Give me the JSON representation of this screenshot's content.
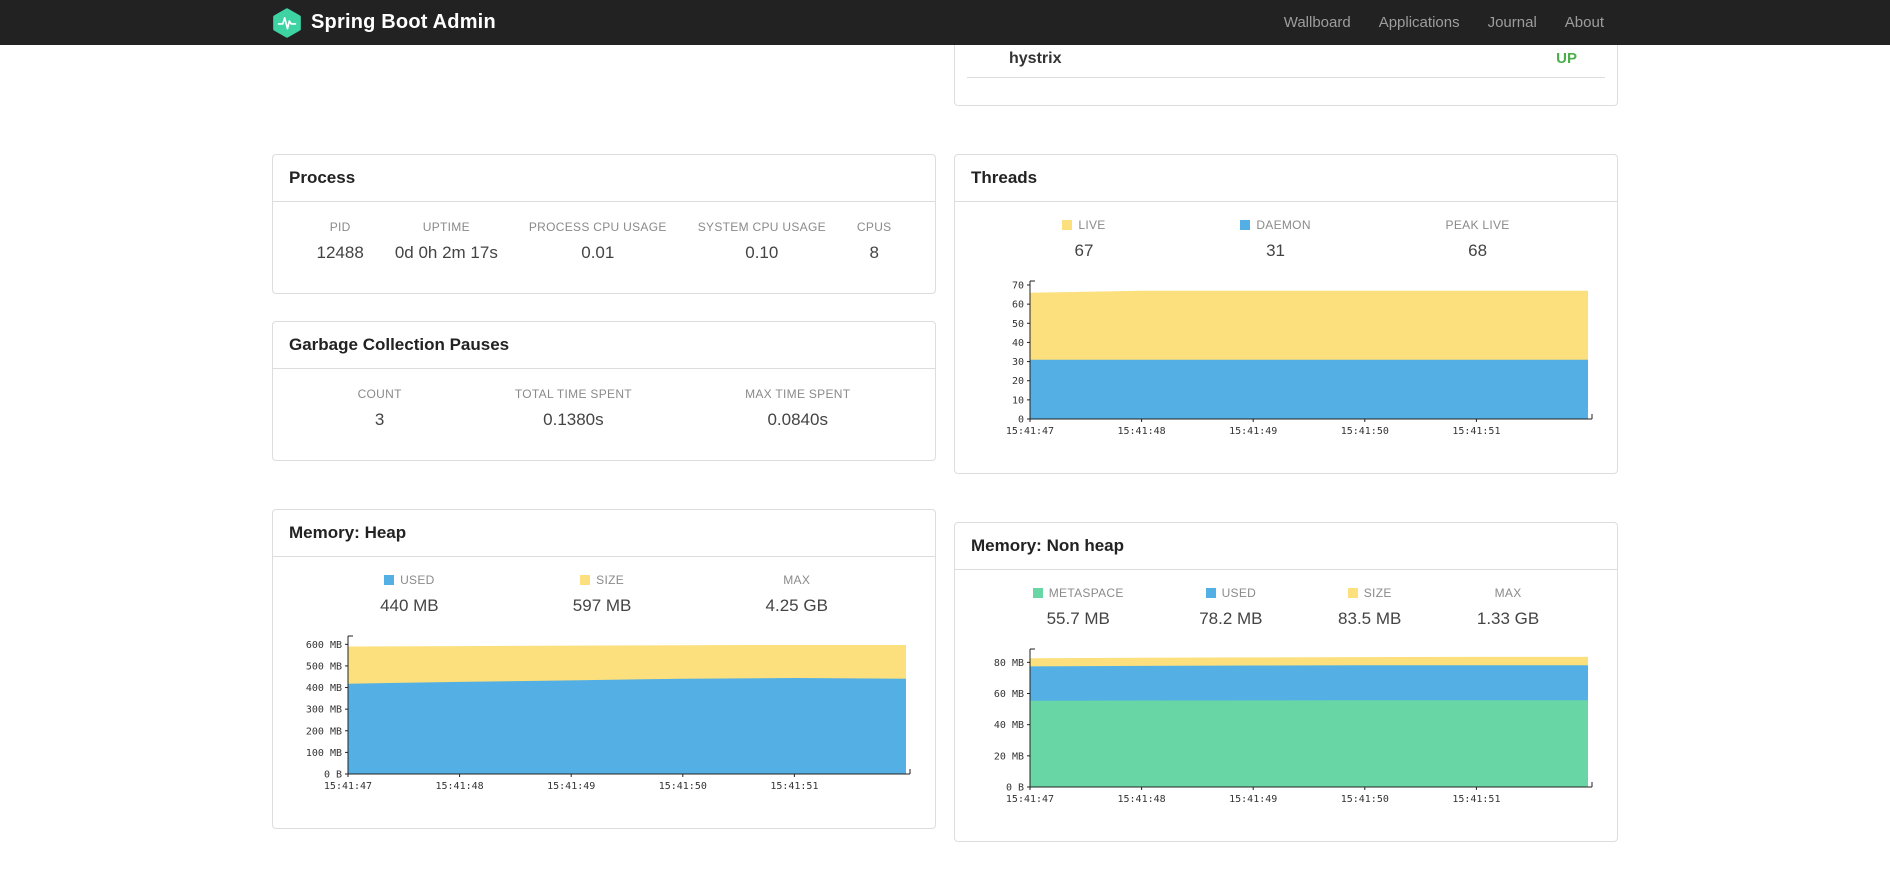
{
  "navbar": {
    "brand": "Spring Boot Admin",
    "items": [
      {
        "label": "Wallboard"
      },
      {
        "label": "Applications"
      },
      {
        "label": "Journal"
      },
      {
        "label": "About"
      }
    ]
  },
  "colors": {
    "logo_teal": "#3ed3a3",
    "status_up": "#4cae4c",
    "chart_yellow": "#fbe07d",
    "chart_blue": "#54b0e4",
    "chart_green": "#68d7a5"
  },
  "health": {
    "rows": [
      {
        "name": "hystrix",
        "status": "UP"
      }
    ]
  },
  "process": {
    "title": "Process",
    "stats": [
      {
        "label": "PID",
        "value": "12488"
      },
      {
        "label": "UPTIME",
        "value": "0d 0h 2m 17s"
      },
      {
        "label": "PROCESS CPU USAGE",
        "value": "0.01"
      },
      {
        "label": "SYSTEM CPU USAGE",
        "value": "0.10"
      },
      {
        "label": "CPUS",
        "value": "8"
      }
    ]
  },
  "gc": {
    "title": "Garbage Collection Pauses",
    "stats": [
      {
        "label": "COUNT",
        "value": "3"
      },
      {
        "label": "TOTAL TIME SPENT",
        "value": "0.1380s"
      },
      {
        "label": "MAX TIME SPENT",
        "value": "0.0840s"
      }
    ]
  },
  "threads": {
    "title": "Threads",
    "legend": [
      {
        "label": "LIVE",
        "value": "67",
        "color": "#fbe07d"
      },
      {
        "label": "DAEMON",
        "value": "31",
        "color": "#54b0e4"
      },
      {
        "label": "PEAK LIVE",
        "value": "68"
      }
    ]
  },
  "heap": {
    "title": "Memory: Heap",
    "legend": [
      {
        "label": "USED",
        "value": "440 MB",
        "color": "#54b0e4"
      },
      {
        "label": "SIZE",
        "value": "597 MB",
        "color": "#fbe07d"
      },
      {
        "label": "MAX",
        "value": "4.25 GB"
      }
    ]
  },
  "nonheap": {
    "title": "Memory: Non heap",
    "legend": [
      {
        "label": "METASPACE",
        "value": "55.7 MB",
        "color": "#68d7a5"
      },
      {
        "label": "USED",
        "value": "78.2 MB",
        "color": "#54b0e4"
      },
      {
        "label": "SIZE",
        "value": "83.5 MB",
        "color": "#fbe07d"
      },
      {
        "label": "MAX",
        "value": "1.33 GB"
      }
    ]
  },
  "chart_data": [
    {
      "id": "threads",
      "type": "area",
      "title": "Threads",
      "stacking": "values are absolute stacked upper bounds, drawn back-to-front",
      "x_labels": [
        "15:41:47",
        "15:41:48",
        "15:41:49",
        "15:41:50",
        "15:41:51"
      ],
      "ylim": [
        0,
        70
      ],
      "yticks": [
        {
          "v": 0,
          "label": "0"
        },
        {
          "v": 10,
          "label": "10"
        },
        {
          "v": 20,
          "label": "20"
        },
        {
          "v": 30,
          "label": "30"
        },
        {
          "v": 40,
          "label": "40"
        },
        {
          "v": 50,
          "label": "50"
        },
        {
          "v": 60,
          "label": "60"
        },
        {
          "v": 70,
          "label": "70"
        }
      ],
      "series": [
        {
          "name": "LIVE",
          "color": "#fbe07d",
          "values": [
            66,
            67,
            67,
            67,
            67,
            67
          ]
        },
        {
          "name": "DAEMON",
          "color": "#54b0e4",
          "values": [
            31,
            31,
            31,
            31,
            31,
            31
          ]
        }
      ]
    },
    {
      "id": "heap",
      "type": "area",
      "title": "Memory: Heap",
      "stacking": "values are absolute stacked upper bounds, drawn back-to-front",
      "x_labels": [
        "15:41:47",
        "15:41:48",
        "15:41:49",
        "15:41:50",
        "15:41:51"
      ],
      "ylim": [
        0,
        620
      ],
      "yticks": [
        {
          "v": 0,
          "label": "0 B"
        },
        {
          "v": 100,
          "label": "100 MB"
        },
        {
          "v": 200,
          "label": "200 MB"
        },
        {
          "v": 300,
          "label": "300 MB"
        },
        {
          "v": 400,
          "label": "400 MB"
        },
        {
          "v": 500,
          "label": "500 MB"
        },
        {
          "v": 600,
          "label": "600 MB"
        }
      ],
      "series": [
        {
          "name": "SIZE",
          "color": "#fbe07d",
          "values": [
            590,
            592,
            594,
            596,
            597,
            597
          ]
        },
        {
          "name": "USED",
          "color": "#54b0e4",
          "values": [
            418,
            426,
            433,
            441,
            444,
            441
          ]
        }
      ]
    },
    {
      "id": "nonheap",
      "type": "area",
      "title": "Memory: Non heap",
      "stacking": "values are absolute stacked upper bounds, drawn back-to-front",
      "x_labels": [
        "15:41:47",
        "15:41:48",
        "15:41:49",
        "15:41:50",
        "15:41:51"
      ],
      "ylim": [
        0,
        86
      ],
      "yticks": [
        {
          "v": 0,
          "label": "0 B"
        },
        {
          "v": 20,
          "label": "20 MB"
        },
        {
          "v": 40,
          "label": "40 MB"
        },
        {
          "v": 60,
          "label": "60 MB"
        },
        {
          "v": 80,
          "label": "80 MB"
        }
      ],
      "series": [
        {
          "name": "SIZE",
          "color": "#fbe07d",
          "values": [
            82.6,
            83,
            83.2,
            83.4,
            83.5,
            83.5
          ]
        },
        {
          "name": "USED",
          "color": "#54b0e4",
          "values": [
            77.4,
            77.7,
            78,
            78.1,
            78.2,
            78.2
          ]
        },
        {
          "name": "METASPACE",
          "color": "#68d7a5",
          "values": [
            55.4,
            55.5,
            55.6,
            55.7,
            55.7,
            55.7
          ]
        }
      ]
    }
  ]
}
